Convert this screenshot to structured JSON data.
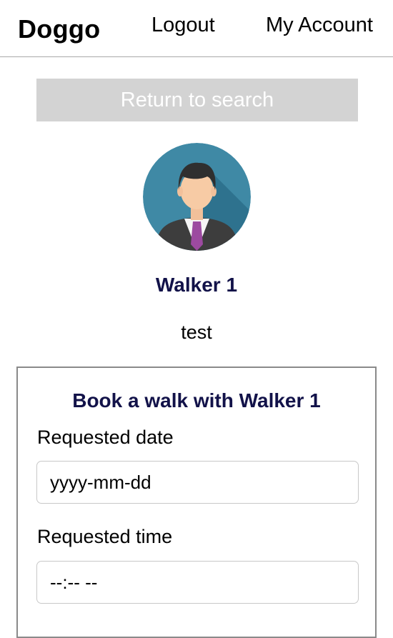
{
  "header": {
    "brand": "Doggo",
    "logout_label": "Logout",
    "account_label": "My Account"
  },
  "return_button": {
    "label": "Return to search"
  },
  "profile": {
    "name": "Walker 1",
    "bio": "test",
    "avatar_icon": "businessman-avatar-icon"
  },
  "booking": {
    "title": "Book a walk with Walker 1",
    "date_label": "Requested date",
    "date_placeholder": "yyyy-mm-dd",
    "time_label": "Requested time",
    "time_placeholder": "--:-- --"
  },
  "colors": {
    "accent": "#121249",
    "button_bg": "#d3d3d3",
    "avatar_bg": "#3f89a5"
  }
}
